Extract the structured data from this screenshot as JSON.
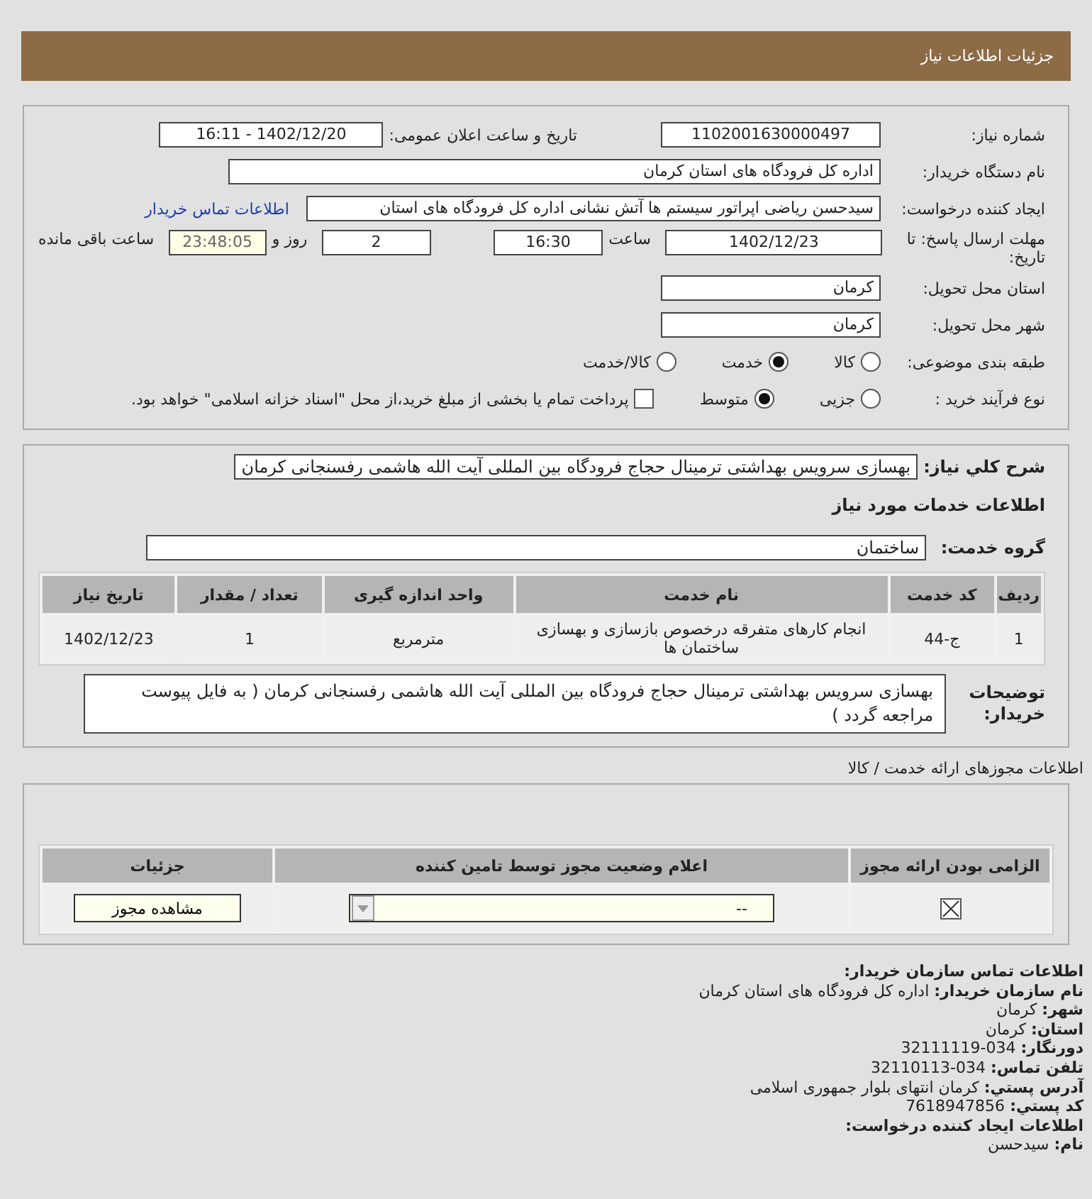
{
  "header": {
    "title": "جزئیات اطلاعات نیاز"
  },
  "need": {
    "number_label": "شماره نیاز:",
    "number": "1102001630000497",
    "announce_label": "تاریخ و ساعت اعلان عمومی:",
    "announce": "1402/12/20 - 16:11",
    "buyer_label": "نام دستگاه خریدار:",
    "buyer": "اداره کل فرودگاه های استان کرمان",
    "creator_label": "ایجاد کننده درخواست:",
    "creator": "سیدحسن ریاضی اپراتور سیستم ها آتش نشانی اداره کل فرودگاه های استان",
    "contact_link": "اطلاعات تماس خریدار",
    "deadline_label": "مهلت ارسال پاسخ: تا تاریخ:",
    "deadline_date": "1402/12/23",
    "time_label": "ساعت",
    "deadline_time": "16:30",
    "days": "2",
    "days_label": "روز و",
    "remaining": "23:48:05",
    "remaining_label": "ساعت باقی مانده",
    "province_label": "استان محل تحویل:",
    "province": "کرمان",
    "city_label": "شهر محل تحویل:",
    "city": "کرمان",
    "category_label": "طبقه بندی موضوعی:",
    "categories": [
      {
        "label": "کالا",
        "selected": false
      },
      {
        "label": "خدمت",
        "selected": true
      },
      {
        "label": "کالا/خدمت",
        "selected": false
      }
    ],
    "process_label": "نوع فرآیند خرید :",
    "processes": [
      {
        "label": "جزیی",
        "selected": false
      },
      {
        "label": "متوسط",
        "selected": true
      }
    ],
    "treasury": {
      "label": "پرداخت تمام یا بخشی از مبلغ خرید،از محل \"اسناد خزانه اسلامی\" خواهد بود.",
      "checked": false
    }
  },
  "details": {
    "summary_label": "شرح کلي نیاز:",
    "summary": "بهسازی سرویس بهداشتی ترمینال حجاج فرودگاه بین المللی آیت الله هاشمی رفسنجانی کرمان",
    "services_heading": "اطلاعات خدمات مورد نیاز",
    "group_label": "گروه خدمت:",
    "group": "ساختمان",
    "table": {
      "columns": [
        "ردیف",
        "کد خدمت",
        "نام خدمت",
        "واحد اندازه گیری",
        "تعداد / مقدار",
        "تاریخ نیاز"
      ],
      "rows": [
        [
          "1",
          "ج-44",
          "انجام کارهای متفرقه درخصوص بازسازی و بهسازی ساختمان ها",
          "مترمربع",
          "1",
          "1402/12/23"
        ]
      ]
    },
    "notes_label": "توضیحات خریدار:",
    "notes": "بهسازی سرویس بهداشتی ترمینال حجاج فرودگاه بین المللی آیت الله هاشمی رفسنجانی کرمان ( به فایل پیوست مراجعه گردد )"
  },
  "licenses": {
    "title": "اطلاعات مجوزهای ارائه خدمت / کالا",
    "columns": [
      "الزامی بودن ارائه مجوز",
      "اعلام وضعیت مجوز توسط تامین کننده",
      "جزئیات"
    ],
    "rows": [
      {
        "required": true,
        "status": "--",
        "button": "مشاهده مجوز"
      }
    ]
  },
  "contact": {
    "heading": "اطلاعات تماس سازمان خریدار:",
    "lines": [
      {
        "label": "نام سازمان خریدار:",
        "value": "اداره کل فرودگاه های استان کرمان"
      },
      {
        "label": "شهر:",
        "value": "کرمان"
      },
      {
        "label": "استان:",
        "value": "کرمان"
      },
      {
        "label": "دورنگار:",
        "value": "034-32111119"
      },
      {
        "label": "تلفن تماس:",
        "value": "034-32110113"
      },
      {
        "label": "آدرس پستي:",
        "value": "کرمان انتهای بلوار جمهوری اسلامی"
      },
      {
        "label": "کد پستي:",
        "value": "7618947856"
      }
    ],
    "creator_heading": "اطلاعات ایجاد کننده درخواست:",
    "creator_lines": [
      {
        "label": "نام:",
        "value": "سیدحسن"
      }
    ]
  }
}
